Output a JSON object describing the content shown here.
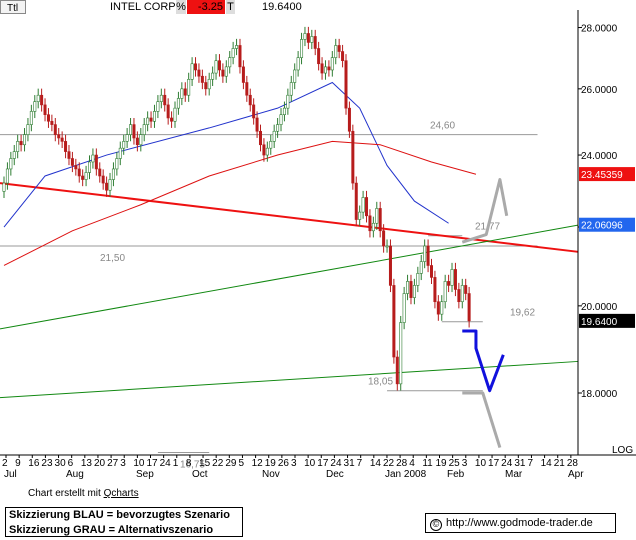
{
  "header": {
    "field_ttl": "Ttl",
    "ticker": "INTEL CORP",
    "pct_label": "%",
    "change": "-3.25",
    "t_label": "T",
    "last": "19.6400"
  },
  "footer": {
    "credit_text": "Chart erstellt mit",
    "credit_link": "Qcharts",
    "legend_line1": "Skizzierung BLAU = bevorzugtes Szenario",
    "legend_line2": "Skizzierung GRAU = Alternativszenario",
    "copyright_symbol": "©",
    "url": "http://www.godmode-trader.de"
  },
  "colors": {
    "price_up": "#2e7d32",
    "price_down": "#b71c1c",
    "ma_blue": "#2233cc",
    "ma_red": "#dd1111",
    "trend_red": "#ee1111",
    "trend_green": "#118811",
    "scenario_blue": "#1111dd",
    "scenario_grey": "#aaaaaa",
    "tag_red_bg": "#ee1111",
    "tag_blue_bg": "#2266ee",
    "tag_last_bg": "#000000"
  },
  "chart_data": {
    "type": "candlestick",
    "y_scale": "log",
    "ylim": [
      16.7,
      28.6
    ],
    "y_ticks": [
      "28.0000",
      "26.0000",
      "24.0000",
      "22.0000",
      "20.0000",
      "18.0000"
    ],
    "y_tick_values": [
      28,
      26,
      24,
      22,
      20,
      18
    ],
    "axis_label_log": "LOG",
    "x_day_labels": [
      "2",
      "9",
      "16",
      "23",
      "30",
      "6",
      "13",
      "20",
      "27",
      "3",
      "10",
      "17",
      "24",
      "1",
      "8",
      "15",
      "22",
      "29",
      "5",
      "12",
      "19",
      "26",
      "3",
      "10",
      "17",
      "24",
      "31",
      "7",
      "14",
      "22",
      "28",
      "4",
      "11",
      "19",
      "25",
      "3",
      "10",
      "17",
      "24",
      "31",
      "7",
      "14",
      "21",
      "28"
    ],
    "x_month_labels": [
      "Jul",
      "Aug",
      "Sep",
      "Oct",
      "Nov",
      "Dec",
      "Jan 2008",
      "Feb",
      "Mar",
      "Apr"
    ],
    "price_close": [
      23.2,
      23.6,
      23.9,
      24.1,
      24.4,
      24.3,
      24.6,
      24.9,
      25.3,
      25.6,
      25.8,
      25.5,
      25.2,
      25.0,
      24.9,
      24.6,
      24.5,
      24.4,
      24.1,
      23.9,
      23.7,
      23.6,
      23.4,
      23.3,
      23.5,
      23.8,
      24.0,
      23.6,
      23.4,
      23.2,
      23.0,
      23.3,
      23.6,
      23.9,
      24.2,
      24.4,
      24.6,
      24.9,
      24.5,
      24.3,
      24.6,
      24.9,
      25.1,
      25.0,
      25.3,
      25.6,
      25.8,
      25.5,
      25.1,
      25.0,
      25.4,
      25.7,
      26.0,
      25.8,
      26.3,
      26.8,
      26.6,
      26.4,
      26.2,
      26.0,
      26.3,
      26.5,
      26.9,
      26.6,
      26.4,
      26.7,
      27.0,
      27.3,
      27.4,
      26.7,
      26.2,
      25.8,
      25.5,
      25.1,
      24.7,
      24.3,
      24.0,
      24.2,
      24.4,
      24.7,
      24.9,
      25.2,
      25.4,
      25.8,
      26.2,
      26.6,
      27.0,
      27.6,
      27.8,
      27.5,
      27.7,
      27.3,
      26.8,
      26.5,
      26.7,
      26.6,
      27.0,
      27.4,
      27.2,
      26.9,
      25.4,
      24.7,
      23.2,
      22.2,
      22.4,
      22.8,
      22.3,
      21.9,
      22.1,
      22.5,
      21.9,
      21.5,
      21.5,
      20.5,
      18.8,
      18.2,
      19.6,
      20.3,
      20.6,
      20.2,
      20.5,
      20.8,
      21.1,
      21.5,
      21.0,
      20.7,
      20.1,
      19.8,
      20.1,
      20.6,
      20.5,
      20.9,
      20.4,
      20.1,
      20.5,
      20.3,
      19.64
    ],
    "series": [
      {
        "name": "MA blue",
        "color": "#2233cc",
        "values": [
          [
            0,
            22.0
          ],
          [
            12,
            23.4
          ],
          [
            30,
            24.0
          ],
          [
            60,
            24.8
          ],
          [
            80,
            25.4
          ],
          [
            96,
            26.2
          ],
          [
            104,
            25.4
          ],
          [
            112,
            23.7
          ],
          [
            120,
            22.7
          ],
          [
            130,
            22.1
          ]
        ]
      },
      {
        "name": "MA red",
        "color": "#dd1111",
        "values": [
          [
            0,
            21.0
          ],
          [
            20,
            21.9
          ],
          [
            40,
            22.6
          ],
          [
            60,
            23.4
          ],
          [
            80,
            24.0
          ],
          [
            96,
            24.4
          ],
          [
            110,
            24.3
          ],
          [
            125,
            23.8
          ],
          [
            138,
            23.45
          ]
        ]
      }
    ],
    "trendlines": [
      {
        "name": "trend red",
        "color": "#ee1111",
        "from": [
          -3,
          23.2
        ],
        "to": [
          156,
          21.35
        ]
      },
      {
        "name": "trend green upper",
        "color": "#118811",
        "from": [
          -3,
          19.45
        ],
        "to": [
          156,
          22.05
        ]
      },
      {
        "name": "trend green lower",
        "color": "#118811",
        "from": [
          -3,
          17.9
        ],
        "to": [
          156,
          18.7
        ]
      }
    ],
    "horizontal_levels": [
      {
        "value": 24.6,
        "label": "24,60",
        "from": -3,
        "to": 156
      },
      {
        "value": 21.5,
        "label": "21,50",
        "from": -3,
        "to": 156
      },
      {
        "value": 21.77,
        "label": "21,77",
        "from": 124,
        "to": 134
      },
      {
        "value": 19.62,
        "label": "19,62",
        "from": 128,
        "to": 140
      },
      {
        "value": 18.05,
        "label": "18,05",
        "from": 112,
        "to": 140
      },
      {
        "value": 16.75,
        "label": "16,75",
        "from": 45,
        "to": 60
      }
    ],
    "scenario_blue": [
      [
        134,
        19.4
      ],
      [
        138,
        19.4
      ],
      [
        138,
        19.0
      ],
      [
        142,
        18.05
      ],
      [
        146,
        18.85
      ]
    ],
    "scenario_grey_up": [
      [
        134,
        21.6
      ],
      [
        141,
        21.8
      ],
      [
        145,
        23.3
      ],
      [
        147,
        22.3
      ]
    ],
    "scenario_grey_down": [
      [
        134,
        18.0
      ],
      [
        140,
        18.0
      ],
      [
        145,
        16.85
      ]
    ],
    "tags": [
      {
        "value": 23.45359,
        "label": "23.45359",
        "style": "red"
      },
      {
        "value": 22.06096,
        "label": "22.06096",
        "style": "blue"
      },
      {
        "value": 19.64,
        "label": "19.6400",
        "style": "last"
      }
    ]
  }
}
